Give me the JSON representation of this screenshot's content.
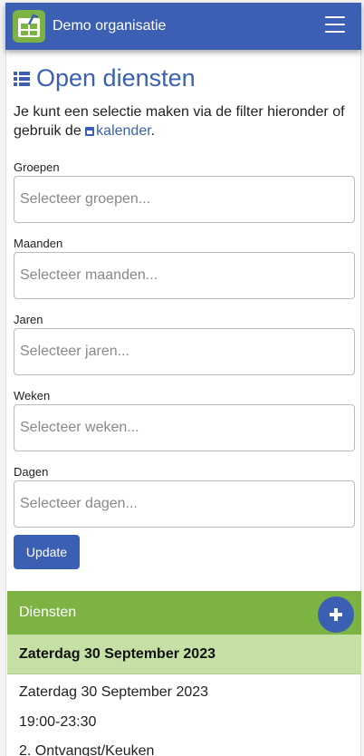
{
  "navbar": {
    "brand": "Demo organisatie",
    "logo_icon": "calendar-logo-icon",
    "menu_icon": "hamburger-icon",
    "colors": {
      "bar": "#3a5fb3",
      "logo": "#7cb342"
    }
  },
  "page": {
    "title": "Open diensten",
    "title_icon": "list-icon",
    "intro_text": "Je kunt een selectie maken via de filter hieronder of gebruik de",
    "calendar_icon": "calendar-icon",
    "calendar_link": "kalender",
    "intro_end": "."
  },
  "filters": [
    {
      "label": "Groepen",
      "placeholder": "Selecteer groepen..."
    },
    {
      "label": "Maanden",
      "placeholder": "Selecteer maanden..."
    },
    {
      "label": "Jaren",
      "placeholder": "Selecteer jaren..."
    },
    {
      "label": "Weken",
      "placeholder": "Selecteer weken..."
    },
    {
      "label": "Dagen",
      "placeholder": "Selecteer dagen..."
    }
  ],
  "update_button": "Update",
  "diensten": {
    "header": "Diensten",
    "add_icon": "plus-icon",
    "colors": {
      "header": "#7cb342",
      "date_row": "#c5e0a5"
    },
    "date_heading": "Zaterdag 30 September 2023",
    "items": [
      {
        "date": "Zaterdag 30 September 2023",
        "time": "19:00-23:30",
        "group": "2. Ontvangst/Keuken"
      }
    ]
  }
}
